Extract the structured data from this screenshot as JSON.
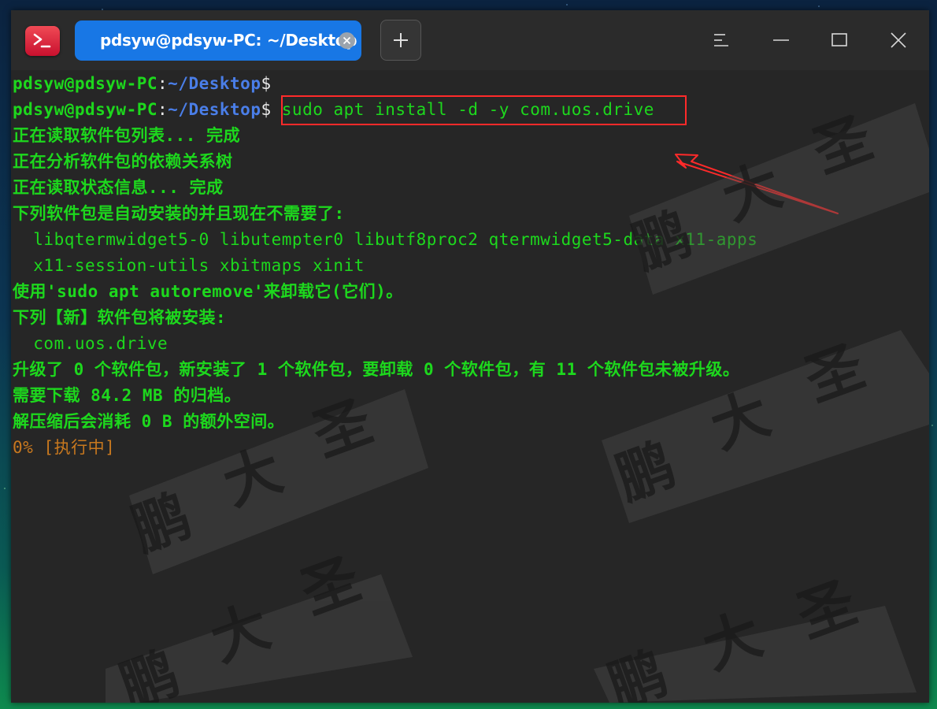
{
  "window": {
    "tab_title": "pdsyw@pdsyw-PC: ~/Desktop",
    "app_icon": "terminal-icon",
    "icons": {
      "tab_close": "close-icon",
      "new_tab": "plus-icon",
      "menu": "menu-icon",
      "minimize": "minimize-icon",
      "maximize": "maximize-icon",
      "close": "close-icon"
    }
  },
  "terminal": {
    "prompt": {
      "user_host": "pdsyw@pdsyw-PC",
      "separator": ":",
      "path": "~/Desktop",
      "symbol": "$"
    },
    "command": "sudo apt install -d -y com.uos.drive",
    "output": [
      "正在读取软件包列表... 完成",
      "正在分析软件包的依赖关系树",
      "正在读取状态信息... 完成",
      "下列软件包是自动安装的并且现在不需要了:",
      "  libqtermwidget5-0 libutempter0 libutf8proc2 qtermwidget5-data x11-apps",
      "  x11-session-utils xbitmaps xinit",
      "使用'sudo apt autoremove'来卸载它(它们)。",
      "下列【新】软件包将被安装:",
      "  com.uos.drive",
      "升级了 0 个软件包，新安装了 1 个软件包，要卸载 0 个软件包，有 11 个软件包未被升级。",
      "需要下载 84.2 MB 的归档。",
      "解压缩后会消耗 0 B 的额外空间。"
    ],
    "progress": "0% [执行中]"
  },
  "watermark": {
    "text": [
      "鹏",
      "大",
      "圣"
    ]
  },
  "colors": {
    "terminal_bg": "#262626",
    "titlebar_bg": "#2b2b2b",
    "tab_active": "#1877e5",
    "prompt_green": "#1dd81d",
    "path_blue": "#4a7ee8",
    "progress_orange": "#c8781e",
    "annotation_red": "#ff2a2a"
  }
}
